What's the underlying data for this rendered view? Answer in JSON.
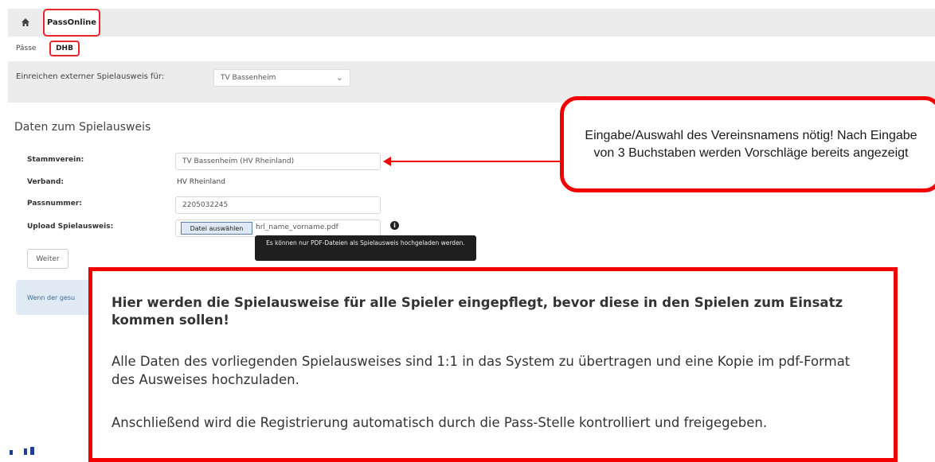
{
  "nav": {
    "home_icon": "home-icon",
    "active_tab": "PassOnline"
  },
  "subnav": {
    "item1": "Pässe",
    "item2": "DHB"
  },
  "club_select": {
    "label": "Einreichen externer Spielausweis für:",
    "value": "TV Bassenheim"
  },
  "form": {
    "title": "Daten zum Spielausweis",
    "stammverein_label": "Stammverein:",
    "stammverein_value": "TV Bassenheim (HV Rheinland)",
    "verband_label": "Verband:",
    "verband_value": "HV Rheinland",
    "passnummer_label": "Passnummer:",
    "passnummer_value": "2205032245",
    "upload_label": "Upload Spielausweis:",
    "file_button": "Datei auswählen",
    "file_name": "hrl_name_vorname.pdf",
    "tooltip": "Es können nur PDF-Dateien als Spielausweis hochgeladen werden.",
    "weiter": "Weiter"
  },
  "info_panel": {
    "text": "Wenn der gesu"
  },
  "callout_top": {
    "text": "Eingabe/Auswahl des Vereinsnamens nötig! Nach Eingabe von 3 Buchstaben werden Vorschläge bereits angezeigt"
  },
  "callout_main": {
    "heading": "Hier werden die Spielausweise für alle Spieler eingepflegt, bevor diese in den Spielen zum Einsatz kommen sollen!",
    "p1": "Alle Daten des vorliegenden Spielausweises sind 1:1 in das System zu übertragen und eine Kopie im pdf-Format des Ausweises hochzuladen.",
    "p2": "Anschließend wird die Registrierung automatisch durch die Pass-Stelle kontrolliert und freigegeben."
  },
  "colors": {
    "highlight": "#f20000",
    "tab_border": "#e8262d",
    "band": "#ececec"
  }
}
